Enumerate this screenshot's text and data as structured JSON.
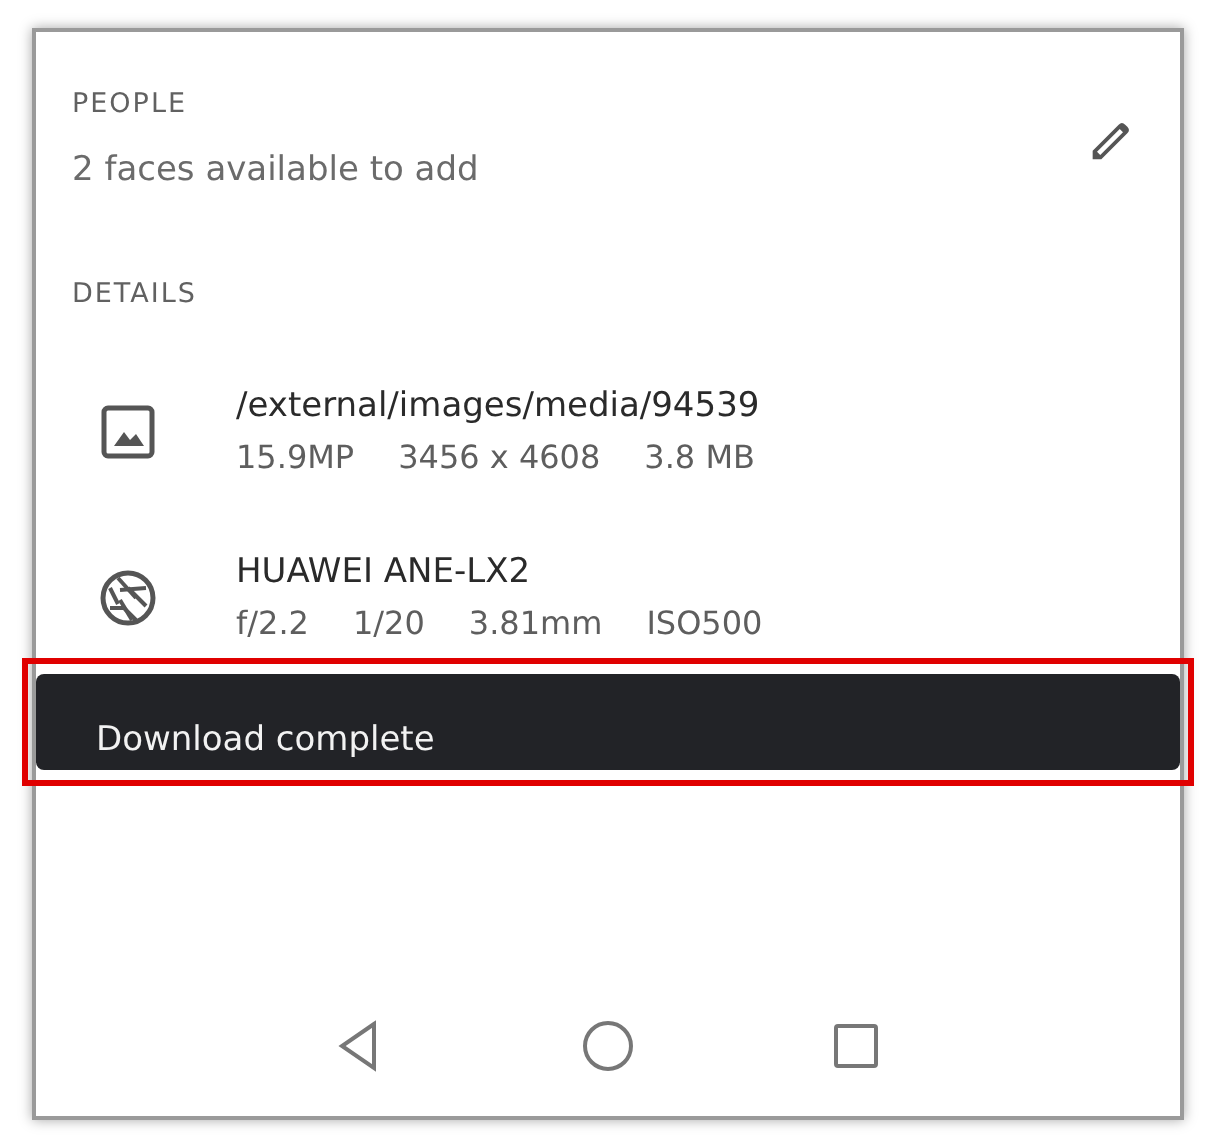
{
  "people": {
    "heading": "PEOPLE",
    "subtitle": "2 faces available to add"
  },
  "details": {
    "heading": "DETAILS",
    "items": [
      {
        "kind": "image",
        "title": "/external/images/media/94539",
        "meta": [
          "15.9MP",
          "3456 x 4608",
          "3.8 MB"
        ]
      },
      {
        "kind": "camera",
        "title": "HUAWEI ANE-LX2",
        "meta": [
          "f/2.2",
          "1/20",
          "3.81mm",
          "ISO500"
        ]
      }
    ]
  },
  "snackbar": {
    "message": "Download complete",
    "highlighted": true
  },
  "nav_bar": {
    "buttons": [
      {
        "kind": "back"
      },
      {
        "kind": "home"
      },
      {
        "kind": "recents"
      }
    ]
  }
}
